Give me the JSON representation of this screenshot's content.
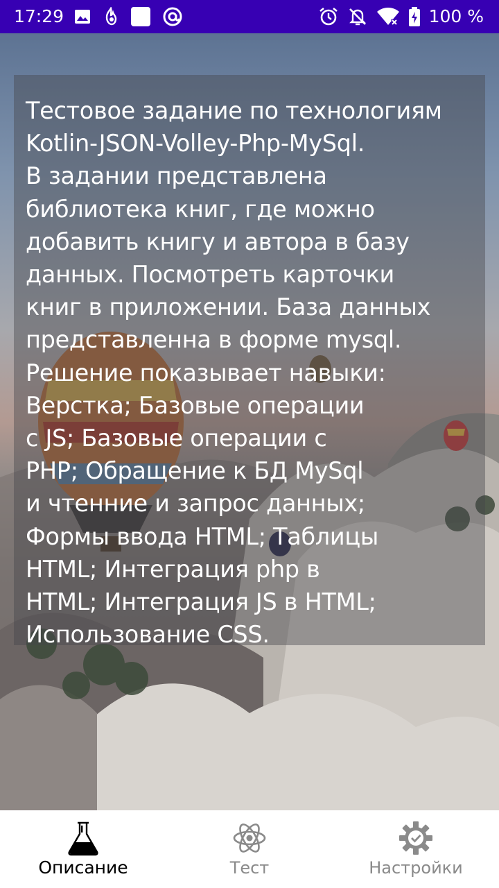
{
  "status_bar": {
    "time": "17:29",
    "battery_text": "100 %",
    "background_color": "#3700b3",
    "left_icons": [
      "image-icon",
      "notification-app-icon",
      "white-square-icon",
      "at-sign-icon"
    ],
    "right_icons": [
      "alarm-icon",
      "do-not-disturb-icon",
      "wifi-icon",
      "battery-icon"
    ]
  },
  "content": {
    "description": "Тестовое задание по технологиям\nKotlin-JSON-Volley-Php-MySql.\nВ задании представлена\nбиблиотека книг, где можно\nдобавить книгу и автора в базу\nданных. Посмотреть карточки\nкниг в приложении. База данных\nпредставленна в форме mysql.\nРешение показывает навыки:\nВерстка; Базовые операции\nс JS; Базовые операции с\nPHP; Обращение  к БД MySql\nи  чтенние и запрос данных;\nФормы ввода HTML; Таблицы\nHTML; Интеграция php в\nHTML; Интеграция JS в HTML;\nИспользование CSS."
  },
  "bottom_nav": {
    "items": [
      {
        "label": "Описание",
        "icon": "flask-icon",
        "active": true
      },
      {
        "label": "Тест",
        "icon": "atom-icon",
        "active": false
      },
      {
        "label": "Настройки",
        "icon": "settings-gear-icon",
        "active": false
      }
    ],
    "active_color": "#000000",
    "inactive_color": "#8a8a8a"
  }
}
